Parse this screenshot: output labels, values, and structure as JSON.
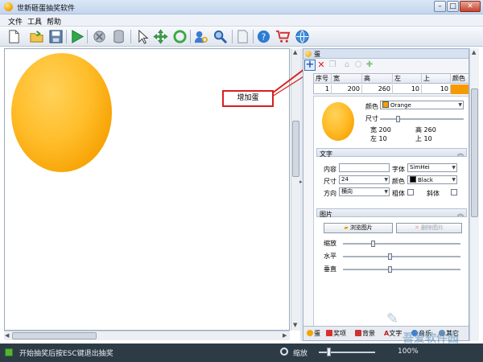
{
  "window": {
    "title": "世新砸蛋抽奖软件",
    "min": "–",
    "max": "□",
    "close": "✕"
  },
  "menu": {
    "items": [
      "文件",
      "工具",
      "帮助"
    ]
  },
  "toolbar": {
    "icons": [
      "new-file-icon",
      "open-folder-icon",
      "save-icon",
      "play-icon",
      "settings-icon",
      "database-icon",
      "pointer-icon",
      "move-icon",
      "refresh-icon",
      "user-search-icon",
      "zoom-icon",
      "document-icon",
      "help-icon",
      "cart-icon",
      "globe-icon"
    ]
  },
  "callout": {
    "text": "增加蛋"
  },
  "panel": {
    "title": "蛋",
    "tools": {
      "add": "+",
      "delete": "✕"
    },
    "grid": {
      "headers": [
        "序号",
        "宽",
        "高",
        "左",
        "上",
        "颜色"
      ],
      "row": [
        "1",
        "200",
        "260",
        "10",
        "10",
        ""
      ]
    },
    "color_label": "颜色",
    "color_value": "Orange",
    "size_label": "尺寸",
    "size_slider": 0.2,
    "width_label": "宽",
    "width_value": "200",
    "height_label": "高",
    "height_value": "260",
    "left_label": "左",
    "left_value": "10",
    "top_label": "上",
    "top_value": "10",
    "text_section": "文字",
    "content_label": "内容",
    "font_label": "字体",
    "font_value": "SimHei",
    "text_size_label": "尺寸",
    "text_size_value": "24",
    "text_color_label": "颜色",
    "text_color_value": "Black",
    "direction_label": "方向",
    "direction_value": "横向",
    "bold_label": "粗体",
    "italic_label": "斜体",
    "image_section": "图片",
    "browse_btn": "浏览图片",
    "delete_img_btn": "删除图片",
    "scale_label": "缩放",
    "scale_slider": 0.25,
    "horizontal_label": "水平",
    "horizontal_slider": 0.4,
    "vertical_label": "垂直",
    "vertical_slider": 0.4,
    "tabs": [
      "蛋",
      "奖项",
      "背景",
      "文字",
      "音乐",
      "其它"
    ]
  },
  "status": {
    "message": "开始抽奖后按ESC键退出抽奖",
    "zoom_label": "缩放",
    "zoom_value": "100%"
  },
  "colors": {
    "egg": "#f6a000",
    "accent": "#d52020",
    "status_bg": "#2d3b46"
  },
  "watermark": {
    "text": "吾爱软件园",
    "url": "www.52z.com"
  }
}
